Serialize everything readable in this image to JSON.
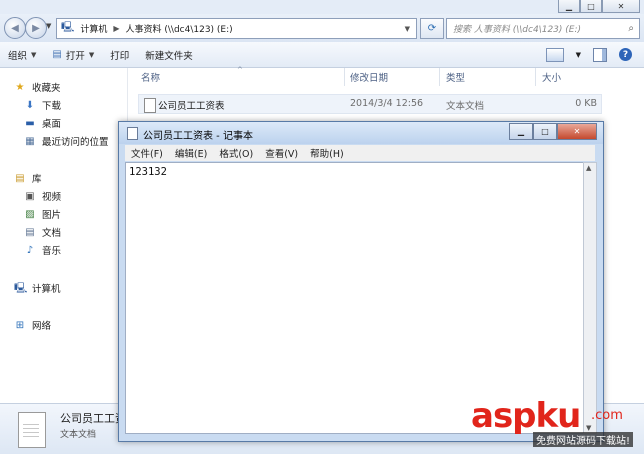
{
  "explorer": {
    "address": {
      "root": "计算机",
      "crumb": "人事资料 (\\\\dc4\\123) (E:)"
    },
    "search_placeholder": "搜索 人事资料 (\\\\dc4\\123) (E:)",
    "toolbar": {
      "organize": "组织",
      "open": "打开",
      "print": "打印",
      "new_folder": "新建文件夹"
    },
    "nav": {
      "favorites": "收藏夹",
      "downloads": "下载",
      "desktop": "桌面",
      "recent": "最近访问的位置",
      "libraries": "库",
      "videos": "视频",
      "pictures": "图片",
      "documents": "文档",
      "music": "音乐",
      "computer": "计算机",
      "network": "网络"
    },
    "columns": {
      "name": "名称",
      "modified": "修改日期",
      "type": "类型",
      "size": "大小"
    },
    "files": [
      {
        "name": "公司员工工资表",
        "modified": "2014/3/4 12:56",
        "type": "文本文档",
        "size": "0 KB"
      }
    ],
    "details": {
      "name": "公司员工工资",
      "type": "文本文档"
    }
  },
  "notepad": {
    "title": "公司员工工资表 - 记事本",
    "menu": {
      "file": "文件(F)",
      "edit": "编辑(E)",
      "format": "格式(O)",
      "view": "查看(V)",
      "help": "帮助(H)"
    },
    "content": "123132"
  },
  "watermark": {
    "brand": "aspku",
    "tld": ".com",
    "slogan": "免费网站源码下载站!"
  }
}
